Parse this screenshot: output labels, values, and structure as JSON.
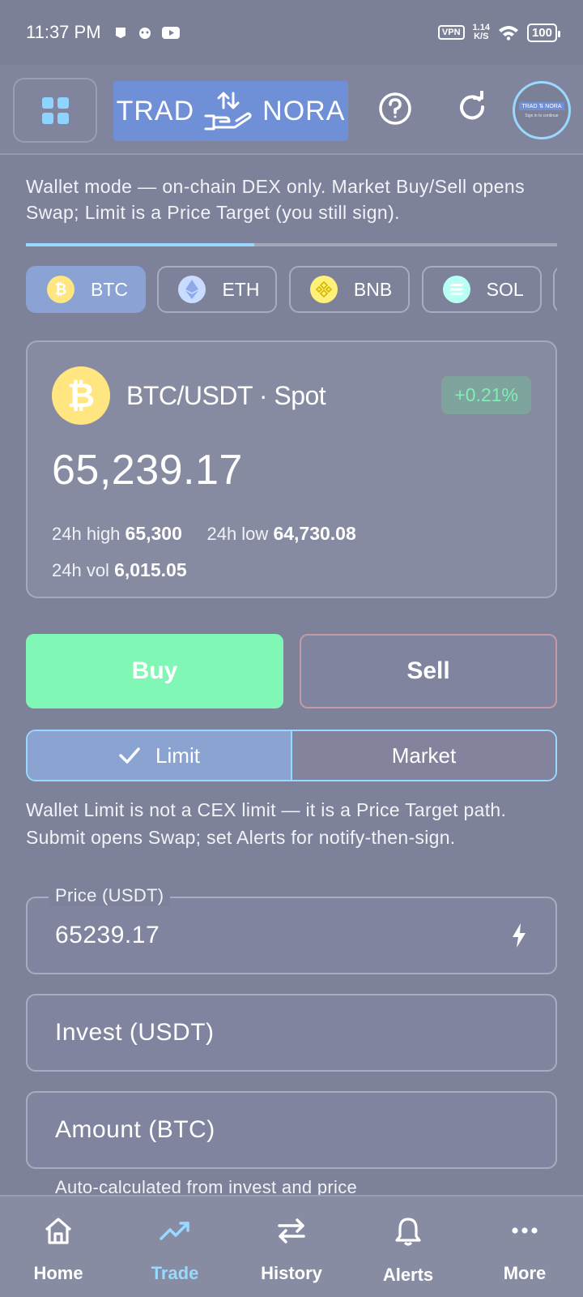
{
  "status_bar": {
    "time": "11:37 PM",
    "vpn": "VPN",
    "speed_value": "1.14",
    "speed_unit": "K/S",
    "battery": "100"
  },
  "header": {
    "logo_left": "TRAD",
    "logo_right": "NORA",
    "avatar_logo_left": "TRAD",
    "avatar_logo_right": "NORA",
    "avatar_caption": "Sign in to continue"
  },
  "notice": "Wallet mode — on-chain DEX only. Market Buy/Sell opens Swap; Limit is a Price Target (you still sign).",
  "progress": 0.43,
  "coins": [
    {
      "symbol": "BTC",
      "glyph": "₿",
      "color": "#ffe680"
    },
    {
      "symbol": "ETH",
      "glyph": "♦",
      "color": "#c9dcff"
    },
    {
      "symbol": "BNB",
      "glyph": "◆",
      "color": "#fff07a"
    },
    {
      "symbol": "SOL",
      "glyph": "≡",
      "color": "#b8fff4"
    }
  ],
  "market": {
    "pair": "BTC/USDT · Spot",
    "change": "+0.21%",
    "price": "65,239.17",
    "high_label": "24h high",
    "high_value": "65,300",
    "low_label": "24h low",
    "low_value": "64,730.08",
    "vol_label": "24h vol",
    "vol_value": "6,015.05"
  },
  "actions": {
    "buy": "Buy",
    "sell": "Sell"
  },
  "order_type": {
    "limit": "Limit",
    "market": "Market",
    "selected": "Limit"
  },
  "hint": "Wallet Limit is not a CEX limit — it is a Price Target path. Submit opens Swap; set Alerts for notify-then-sign.",
  "form": {
    "price_label": "Price (USDT)",
    "price_value": "65239.17",
    "invest_placeholder": "Invest (USDT)",
    "amount_placeholder": "Amount (BTC)",
    "amount_note": "Auto-calculated from invest and price"
  },
  "nav": [
    {
      "label": "Home",
      "icon": "home-icon"
    },
    {
      "label": "Trade",
      "icon": "trend-icon",
      "active": true
    },
    {
      "label": "History",
      "icon": "swap-arrows-icon"
    },
    {
      "label": "Alerts",
      "icon": "bell-icon"
    },
    {
      "label": "More",
      "icon": "more-dots-icon"
    }
  ],
  "colors": {
    "accent": "#9ad9ff",
    "buy": "#80f7b4",
    "positive_text": "#7ff0b5",
    "logo_bg": "#6f8fd6"
  }
}
